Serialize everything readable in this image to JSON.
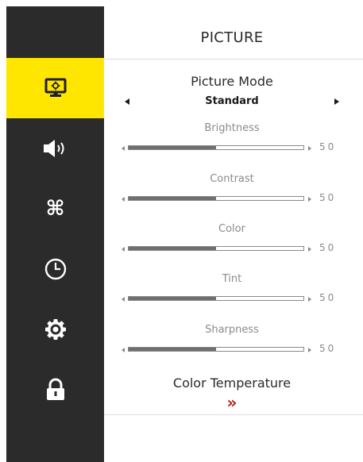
{
  "sidebar": {
    "items": [
      {
        "icon": "picture-icon",
        "active": true
      },
      {
        "icon": "sound-icon",
        "active": false
      },
      {
        "icon": "command-icon",
        "active": false
      },
      {
        "icon": "timer-icon",
        "active": false
      },
      {
        "icon": "settings-icon",
        "active": false
      },
      {
        "icon": "lock-icon",
        "active": false
      }
    ],
    "active_color": "#ffe600",
    "background_color": "#2b2b2b"
  },
  "header": {
    "title": "PICTURE"
  },
  "picture_mode": {
    "label": "Picture Mode",
    "value": "Standard"
  },
  "settings": [
    {
      "label": "Brightness",
      "value": "50",
      "level": 50
    },
    {
      "label": "Contrast",
      "value": "50",
      "level": 50
    },
    {
      "label": "Color",
      "value": "50",
      "level": 50
    },
    {
      "label": "Tint",
      "value": "50",
      "level": 50
    },
    {
      "label": "Sharpness",
      "value": "50",
      "level": 50
    }
  ],
  "color_temperature": {
    "label": "Color Temperature",
    "arrow": "»",
    "arrow_color": "#b0201c"
  }
}
